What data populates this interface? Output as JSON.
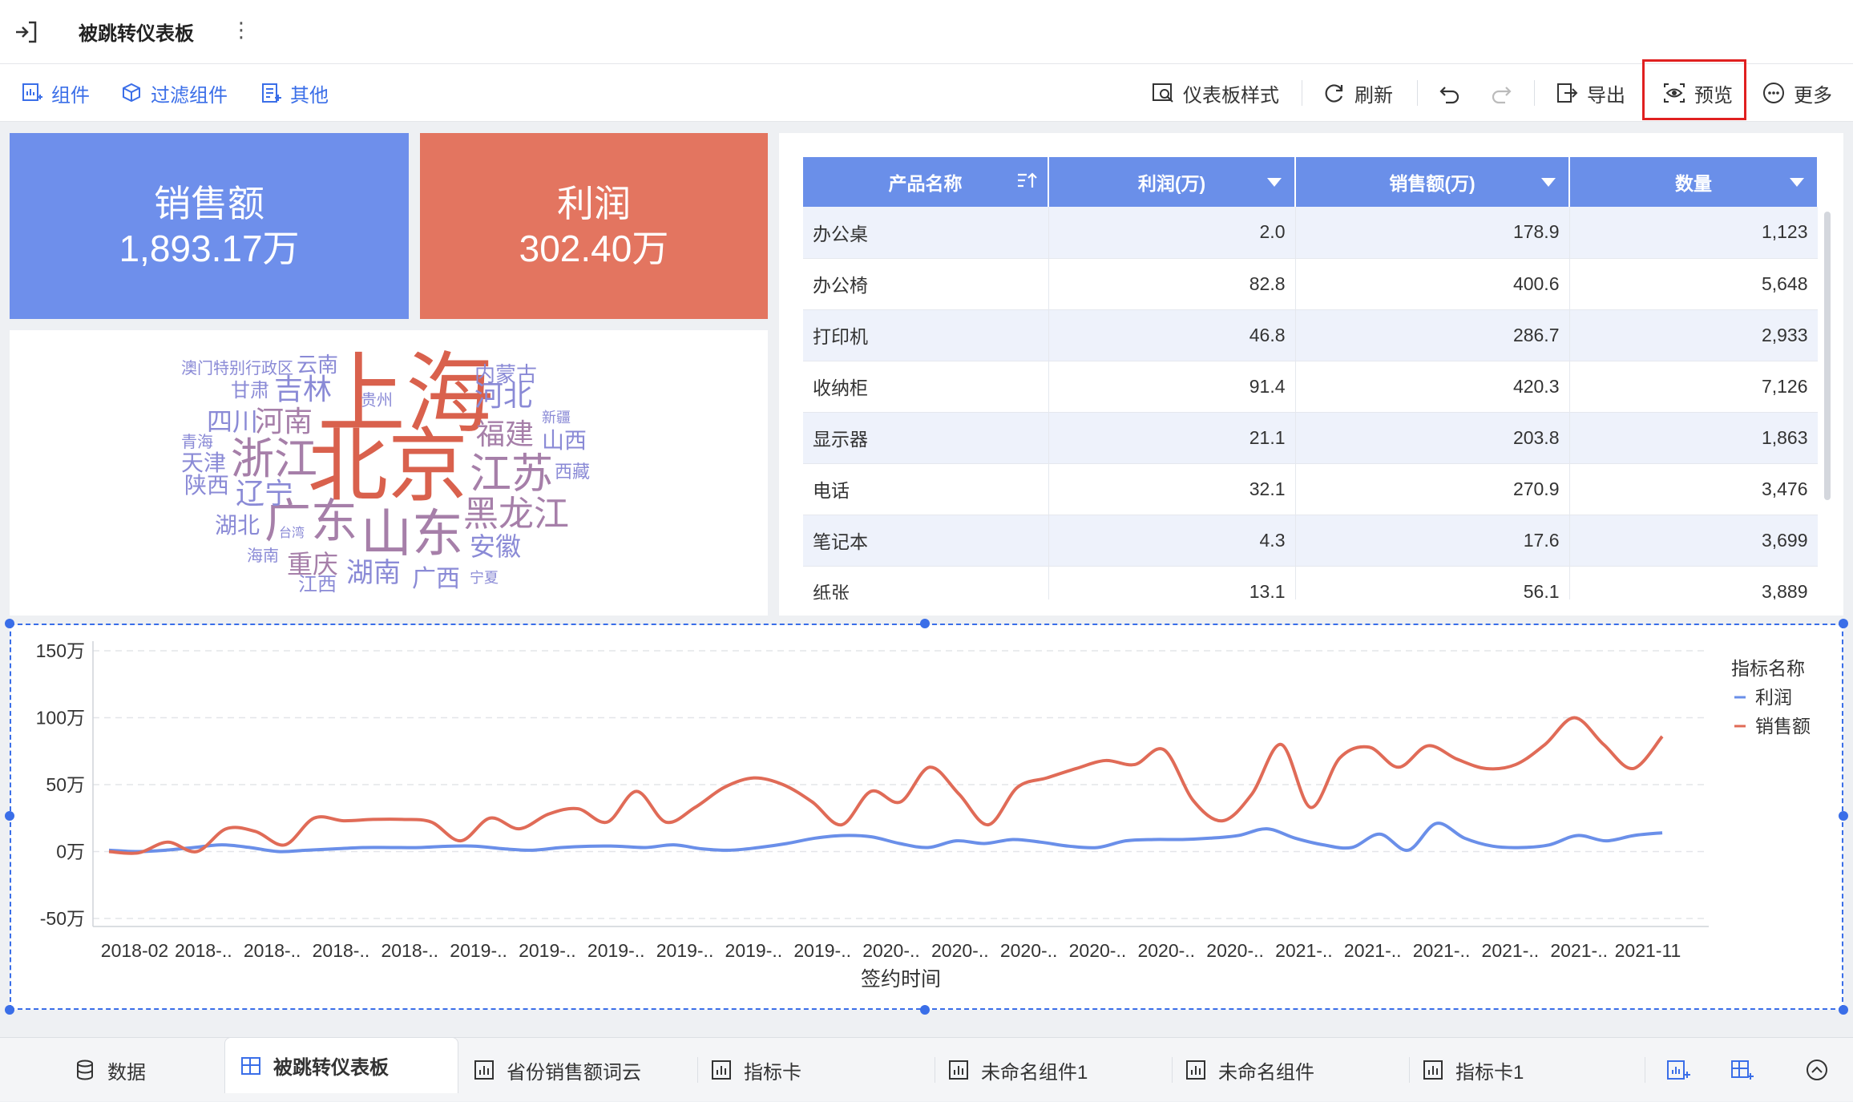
{
  "header": {
    "title": "被跳转仪表板"
  },
  "toolbar": {
    "component": "组件",
    "filter": "过滤组件",
    "other": "其他",
    "style": "仪表板样式",
    "refresh": "刷新",
    "export": "导出",
    "preview": "预览",
    "more": "更多"
  },
  "cards": [
    {
      "title": "销售额",
      "value": "1,893.17万",
      "color": "#6e8feb"
    },
    {
      "title": "利润",
      "value": "302.40万",
      "color": "#e37560"
    }
  ],
  "wordcloud": {
    "words": [
      "上海",
      "北京",
      "浙江",
      "广东",
      "山东",
      "江苏",
      "黑龙江",
      "河北",
      "吉林",
      "河南",
      "四川",
      "福建",
      "辽宁",
      "天津",
      "陕西",
      "湖北",
      "重庆",
      "湖南",
      "安徽",
      "广西",
      "江西",
      "山西",
      "内蒙古",
      "云南",
      "甘肃",
      "贵州",
      "新疆",
      "西藏",
      "青海",
      "台湾",
      "海南",
      "宁夏",
      "澳门特别行政区"
    ]
  },
  "table": {
    "columns": [
      "产品名称",
      "利润(万)",
      "销售额(万)",
      "数量"
    ],
    "rows": [
      [
        "办公桌",
        "2.0",
        "178.9",
        "1,123"
      ],
      [
        "办公椅",
        "82.8",
        "400.6",
        "5,648"
      ],
      [
        "打印机",
        "46.8",
        "286.7",
        "2,933"
      ],
      [
        "收纳柜",
        "91.4",
        "420.3",
        "7,126"
      ],
      [
        "显示器",
        "21.1",
        "203.8",
        "1,863"
      ],
      [
        "电话",
        "32.1",
        "270.9",
        "3,476"
      ],
      [
        "笔记本",
        "4.3",
        "17.6",
        "3,699"
      ],
      [
        "纸张",
        "13.1",
        "56.1",
        "3,889"
      ]
    ]
  },
  "chart_data": {
    "type": "line",
    "xlabel": "签约时间",
    "ylabel": "",
    "y_ticks": [
      "150万",
      "100万",
      "50万",
      "0万",
      "-50万"
    ],
    "ylim": [
      -50,
      150
    ],
    "x_tick_labels": [
      "2018-02",
      "2018-..",
      "2018-..",
      "2018-..",
      "2018-..",
      "2019-..",
      "2019-..",
      "2019-..",
      "2019-..",
      "2019-..",
      "2019-..",
      "2020-..",
      "2020-..",
      "2020-..",
      "2020-..",
      "2020-..",
      "2020-..",
      "2021-..",
      "2021-..",
      "2021-..",
      "2021-..",
      "2021-..",
      "2021-11"
    ],
    "legend_title": "指标名称",
    "legend_position": "right",
    "series": [
      {
        "name": "利润",
        "color": "#6a8fe9",
        "values": [
          1,
          0,
          1,
          3,
          5,
          3,
          0,
          1,
          2,
          3,
          3,
          3,
          4,
          4,
          2,
          1,
          3,
          4,
          4,
          3,
          5,
          2,
          1,
          3,
          6,
          10,
          12,
          11,
          6,
          3,
          8,
          6,
          9,
          7,
          4,
          3,
          8,
          9,
          9,
          10,
          12,
          17,
          10,
          5,
          3,
          13,
          1,
          21,
          10,
          4,
          3,
          5,
          12,
          8,
          12,
          14
        ]
      },
      {
        "name": "销售额",
        "color": "#e06b57",
        "values": [
          0,
          -1,
          7,
          0,
          17,
          15,
          5,
          25,
          23,
          24,
          24,
          22,
          8,
          25,
          17,
          28,
          32,
          22,
          45,
          22,
          33,
          48,
          55,
          50,
          37,
          20,
          45,
          37,
          63,
          43,
          20,
          48,
          55,
          62,
          68,
          65,
          76,
          38,
          23,
          43,
          80,
          33,
          70,
          78,
          63,
          79,
          69,
          62,
          65,
          80,
          100,
          80,
          62,
          86
        ]
      }
    ]
  },
  "bottom_tabs": [
    "数据",
    "被跳转仪表板",
    "省份销售额词云",
    "指标卡",
    "未命名组件1",
    "未命名组件",
    "指标卡1"
  ]
}
